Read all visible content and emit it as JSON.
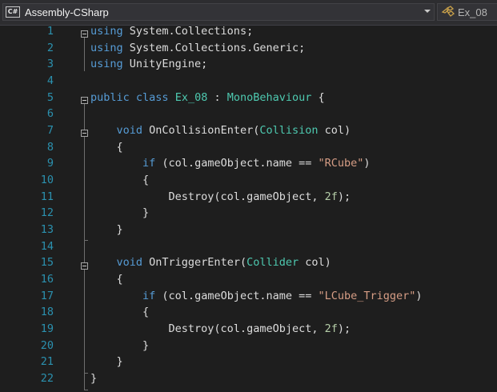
{
  "navbar": {
    "project_icon": "csharp-project-icon",
    "project_icon_label": "C#",
    "project_name": "Assembly-CSharp",
    "class_icon": "class-icon",
    "class_name": "Ex_08"
  },
  "colors": {
    "background": "#1e1e1e",
    "line_number": "#2b91af",
    "keyword": "#569cd6",
    "type": "#4ec9b0",
    "string": "#d69d85",
    "number": "#b5cea8",
    "plain": "#dcdcdc"
  },
  "editor": {
    "lines": [
      {
        "number": "1",
        "tokens": [
          [
            "keyword",
            "using"
          ],
          [
            "plain",
            " System.Collections;"
          ]
        ]
      },
      {
        "number": "2",
        "tokens": [
          [
            "keyword",
            "using"
          ],
          [
            "plain",
            " System.Collections.Generic;"
          ]
        ]
      },
      {
        "number": "3",
        "tokens": [
          [
            "keyword",
            "using"
          ],
          [
            "plain",
            " UnityEngine;"
          ]
        ]
      },
      {
        "number": "4",
        "tokens": []
      },
      {
        "number": "5",
        "tokens": [
          [
            "keyword",
            "public"
          ],
          [
            "plain",
            " "
          ],
          [
            "keyword",
            "class"
          ],
          [
            "plain",
            " "
          ],
          [
            "type",
            "Ex_08"
          ],
          [
            "plain",
            " : "
          ],
          [
            "type",
            "MonoBehaviour"
          ],
          [
            "plain",
            " {"
          ]
        ]
      },
      {
        "number": "6",
        "tokens": []
      },
      {
        "number": "7",
        "tokens": [
          [
            "plain",
            "    "
          ],
          [
            "keyword",
            "void"
          ],
          [
            "plain",
            " OnCollisionEnter("
          ],
          [
            "type",
            "Collision"
          ],
          [
            "plain",
            " col)"
          ]
        ]
      },
      {
        "number": "8",
        "tokens": [
          [
            "plain",
            "    {"
          ]
        ]
      },
      {
        "number": "9",
        "tokens": [
          [
            "plain",
            "        "
          ],
          [
            "keyword",
            "if"
          ],
          [
            "plain",
            " (col.gameObject.name == "
          ],
          [
            "string",
            "\"RCube\""
          ],
          [
            "plain",
            ")"
          ]
        ]
      },
      {
        "number": "10",
        "tokens": [
          [
            "plain",
            "        {"
          ]
        ]
      },
      {
        "number": "11",
        "tokens": [
          [
            "plain",
            "            Destroy(col.gameObject, "
          ],
          [
            "number",
            "2f"
          ],
          [
            "plain",
            ");"
          ]
        ]
      },
      {
        "number": "12",
        "tokens": [
          [
            "plain",
            "        }"
          ]
        ]
      },
      {
        "number": "13",
        "tokens": [
          [
            "plain",
            "    }"
          ]
        ]
      },
      {
        "number": "14",
        "tokens": []
      },
      {
        "number": "15",
        "tokens": [
          [
            "plain",
            "    "
          ],
          [
            "keyword",
            "void"
          ],
          [
            "plain",
            " OnTriggerEnter("
          ],
          [
            "type",
            "Collider"
          ],
          [
            "plain",
            " col)"
          ]
        ]
      },
      {
        "number": "16",
        "tokens": [
          [
            "plain",
            "    {"
          ]
        ]
      },
      {
        "number": "17",
        "tokens": [
          [
            "plain",
            "        "
          ],
          [
            "keyword",
            "if"
          ],
          [
            "plain",
            " (col.gameObject.name == "
          ],
          [
            "string",
            "\"LCube_Trigger\""
          ],
          [
            "plain",
            ")"
          ]
        ]
      },
      {
        "number": "18",
        "tokens": [
          [
            "plain",
            "        {"
          ]
        ]
      },
      {
        "number": "19",
        "tokens": [
          [
            "plain",
            "            Destroy(col.gameObject, "
          ],
          [
            "number",
            "2f"
          ],
          [
            "plain",
            ");"
          ]
        ]
      },
      {
        "number": "20",
        "tokens": [
          [
            "plain",
            "        }"
          ]
        ]
      },
      {
        "number": "21",
        "tokens": [
          [
            "plain",
            "    }"
          ]
        ]
      },
      {
        "number": "22",
        "tokens": [
          [
            "plain",
            "}"
          ]
        ]
      }
    ]
  }
}
